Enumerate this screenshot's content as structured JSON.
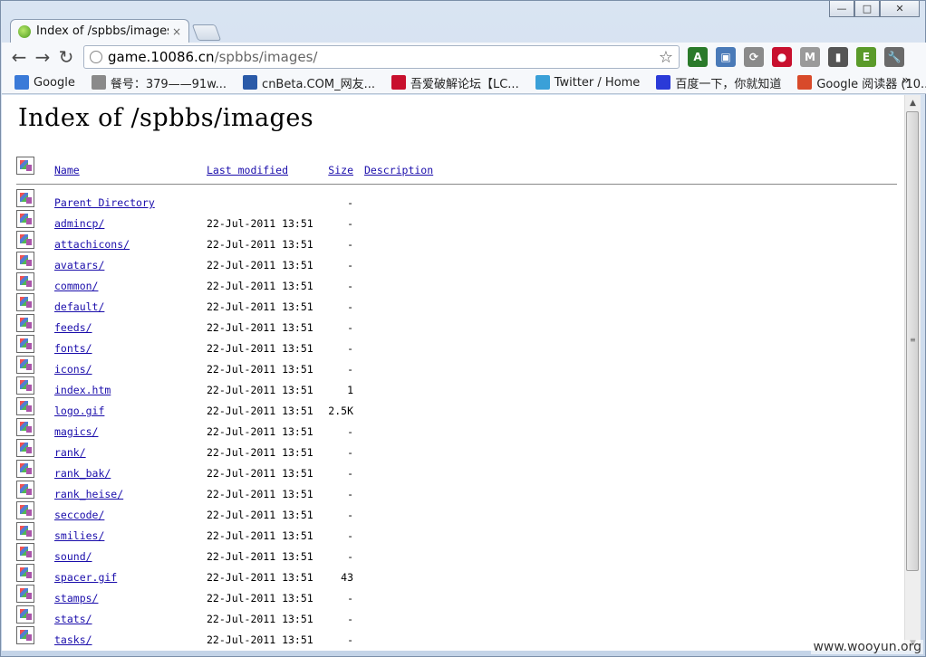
{
  "window": {
    "controls": {
      "minimize": "—",
      "maximize": "□",
      "close": "✕"
    }
  },
  "tabs": [
    {
      "title": "Index of /spbbs/images",
      "close": "×"
    }
  ],
  "toolbar": {
    "back": "←",
    "forward": "→",
    "reload": "↻",
    "url_host": "game.10086.cn",
    "url_path": "/spbbs/images/",
    "star": "☆",
    "extensions": [
      {
        "icon": "translate-icon",
        "glyph": "A",
        "color": "#2a7a2a"
      },
      {
        "icon": "screenshot-icon",
        "glyph": "▣",
        "color": "#4a7ab8"
      },
      {
        "icon": "sync-icon",
        "glyph": "⟳",
        "color": "#8a8a8a"
      },
      {
        "icon": "stop-icon",
        "glyph": "●",
        "color": "#c8102e"
      },
      {
        "icon": "gmail-icon",
        "glyph": "M",
        "color": "#9a9a9a",
        "badge": "?"
      },
      {
        "icon": "phone-icon",
        "glyph": "▮",
        "color": "#555555",
        "badge": "3"
      },
      {
        "icon": "evernote-icon",
        "glyph": "E",
        "color": "#5a9a2a"
      },
      {
        "icon": "wrench-icon",
        "glyph": "🔧",
        "color": "#6a6a6a"
      }
    ]
  },
  "bookmarks": {
    "items": [
      {
        "label": "Google",
        "icon": "google-icon",
        "color": "#3a7ad8"
      },
      {
        "label": "餐号：379——91w...",
        "icon": "globe-icon",
        "color": "#8a8a8a"
      },
      {
        "label": "cnBeta.COM_网友...",
        "icon": "cnbeta-icon",
        "color": "#2a5aa8"
      },
      {
        "label": "吾爱破解论坛【LC...",
        "icon": "52pojie-icon",
        "color": "#c8102e"
      },
      {
        "label": "Twitter / Home",
        "icon": "twitter-icon",
        "color": "#3aa0d8"
      },
      {
        "label": "百度一下，你就知道",
        "icon": "baidu-icon",
        "color": "#2a3ad8"
      },
      {
        "label": "Google 阅读器 (10...",
        "icon": "google-reader-icon",
        "color": "#d84a2a"
      }
    ],
    "more": "»"
  },
  "page": {
    "heading": "Index of /spbbs/images",
    "columns": {
      "name": "Name",
      "last_modified": "Last modified",
      "size": "Size",
      "description": "Description"
    },
    "entries": [
      {
        "name": "Parent Directory",
        "date": "",
        "size": "-"
      },
      {
        "name": "admincp/",
        "date": "22-Jul-2011 13:51",
        "size": "-"
      },
      {
        "name": "attachicons/",
        "date": "22-Jul-2011 13:51",
        "size": "-"
      },
      {
        "name": "avatars/",
        "date": "22-Jul-2011 13:51",
        "size": "-"
      },
      {
        "name": "common/",
        "date": "22-Jul-2011 13:51",
        "size": "-"
      },
      {
        "name": "default/",
        "date": "22-Jul-2011 13:51",
        "size": "-"
      },
      {
        "name": "feeds/",
        "date": "22-Jul-2011 13:51",
        "size": "-"
      },
      {
        "name": "fonts/",
        "date": "22-Jul-2011 13:51",
        "size": "-"
      },
      {
        "name": "icons/",
        "date": "22-Jul-2011 13:51",
        "size": "-"
      },
      {
        "name": "index.htm",
        "date": "22-Jul-2011 13:51",
        "size": "1"
      },
      {
        "name": "logo.gif",
        "date": "22-Jul-2011 13:51",
        "size": "2.5K"
      },
      {
        "name": "magics/",
        "date": "22-Jul-2011 13:51",
        "size": "-"
      },
      {
        "name": "rank/",
        "date": "22-Jul-2011 13:51",
        "size": "-"
      },
      {
        "name": "rank_bak/",
        "date": "22-Jul-2011 13:51",
        "size": "-"
      },
      {
        "name": "rank_heise/",
        "date": "22-Jul-2011 13:51",
        "size": "-"
      },
      {
        "name": "seccode/",
        "date": "22-Jul-2011 13:51",
        "size": "-"
      },
      {
        "name": "smilies/",
        "date": "22-Jul-2011 13:51",
        "size": "-"
      },
      {
        "name": "sound/",
        "date": "22-Jul-2011 13:51",
        "size": "-"
      },
      {
        "name": "spacer.gif",
        "date": "22-Jul-2011 13:51",
        "size": "43"
      },
      {
        "name": "stamps/",
        "date": "22-Jul-2011 13:51",
        "size": "-"
      },
      {
        "name": "stats/",
        "date": "22-Jul-2011 13:51",
        "size": "-"
      },
      {
        "name": "tasks/",
        "date": "22-Jul-2011 13:51",
        "size": "-"
      }
    ]
  },
  "watermark": "www.wooyun.org"
}
